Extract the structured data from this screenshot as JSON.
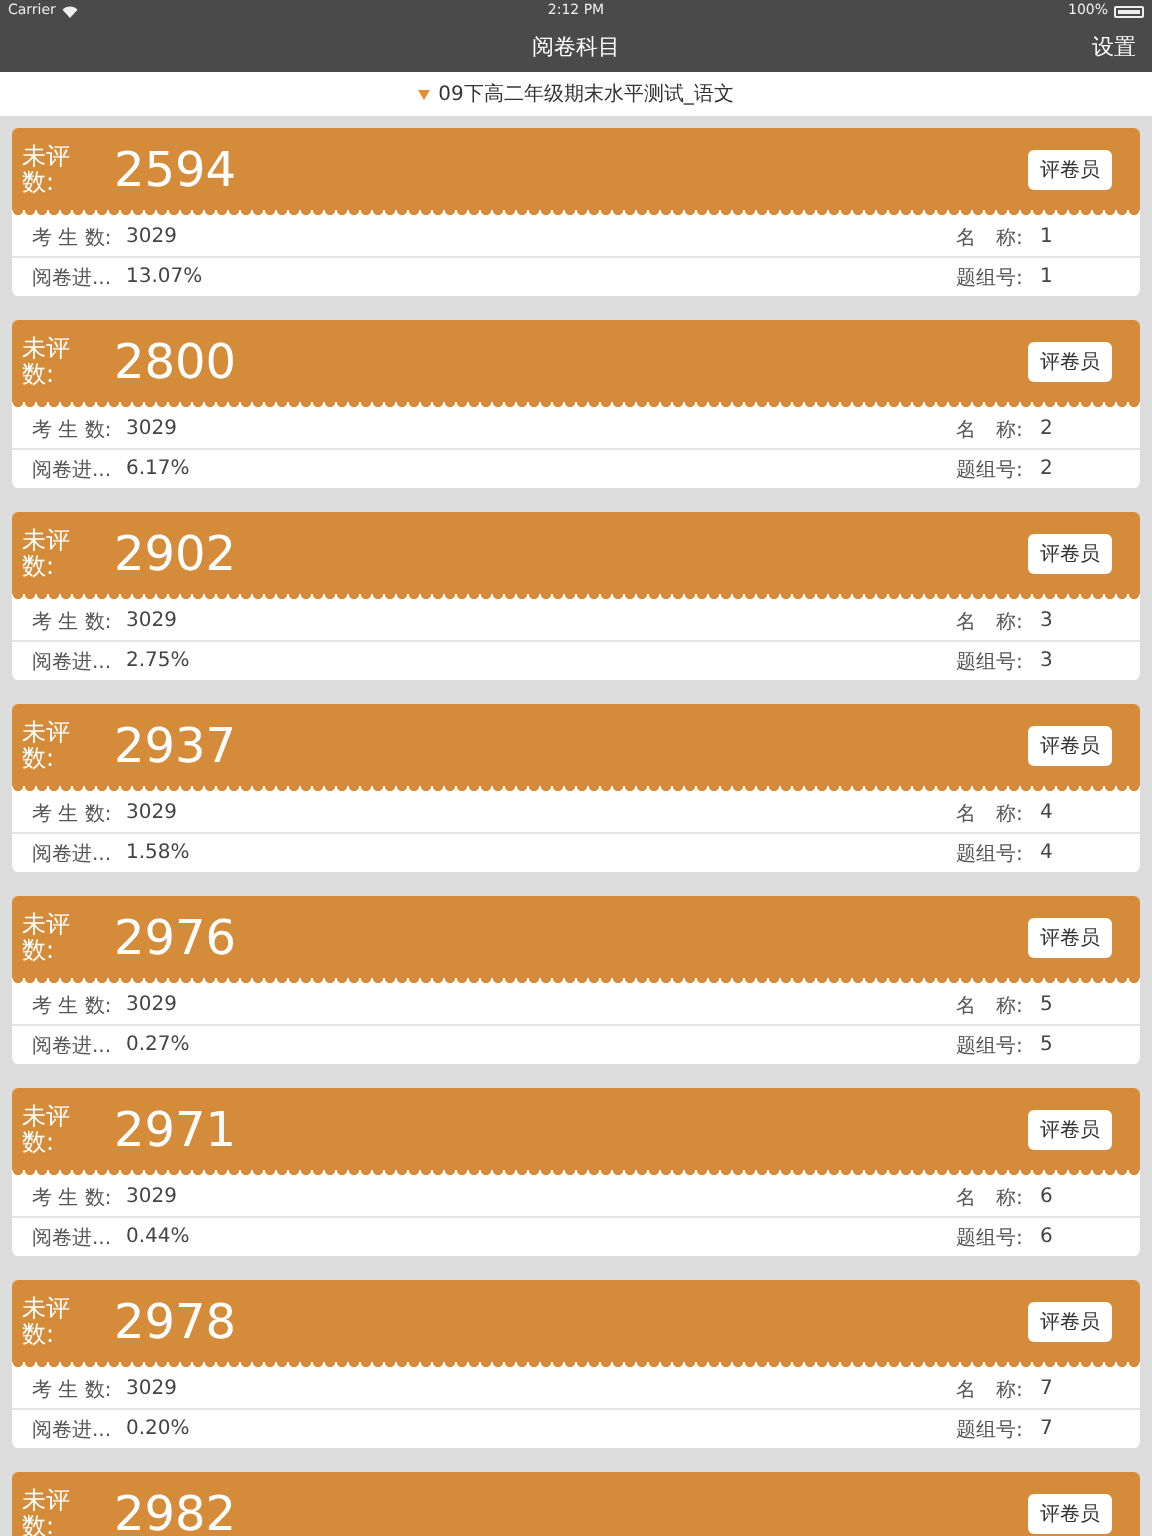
{
  "status_bar": {
    "carrier": "Carrier",
    "time": "2:12 PM",
    "battery": "100%"
  },
  "nav": {
    "title": "阅卷科目",
    "action": "设置"
  },
  "exam": {
    "title": "09下高二年级期末水平测试_语文"
  },
  "cards": [
    {
      "label": "未评数:",
      "count": "2594",
      "button": "评卷员",
      "rows": [
        {
          "left_label": "考 生 数:",
          "left_value": "3029",
          "right_label": "名　称:",
          "right_value": "1"
        },
        {
          "left_label": "阅卷进...",
          "left_value": "13.07%",
          "right_label": "题组号:",
          "right_value": "1"
        }
      ]
    },
    {
      "label": "未评数:",
      "count": "2800",
      "button": "评卷员",
      "rows": [
        {
          "left_label": "考 生 数:",
          "left_value": "3029",
          "right_label": "名　称:",
          "right_value": "2"
        },
        {
          "left_label": "阅卷进...",
          "left_value": "6.17%",
          "right_label": "题组号:",
          "right_value": "2"
        }
      ]
    },
    {
      "label": "未评数:",
      "count": "2902",
      "button": "评卷员",
      "rows": [
        {
          "left_label": "考 生 数:",
          "left_value": "3029",
          "right_label": "名　称:",
          "right_value": "3"
        },
        {
          "left_label": "阅卷进...",
          "left_value": "2.75%",
          "right_label": "题组号:",
          "right_value": "3"
        }
      ]
    },
    {
      "label": "未评数:",
      "count": "2937",
      "button": "评卷员",
      "rows": [
        {
          "left_label": "考 生 数:",
          "left_value": "3029",
          "right_label": "名　称:",
          "right_value": "4"
        },
        {
          "left_label": "阅卷进...",
          "left_value": "1.58%",
          "right_label": "题组号:",
          "right_value": "4"
        }
      ]
    },
    {
      "label": "未评数:",
      "count": "2976",
      "button": "评卷员",
      "rows": [
        {
          "left_label": "考 生 数:",
          "left_value": "3029",
          "right_label": "名　称:",
          "right_value": "5"
        },
        {
          "left_label": "阅卷进...",
          "left_value": "0.27%",
          "right_label": "题组号:",
          "right_value": "5"
        }
      ]
    },
    {
      "label": "未评数:",
      "count": "2971",
      "button": "评卷员",
      "rows": [
        {
          "left_label": "考 生 数:",
          "left_value": "3029",
          "right_label": "名　称:",
          "right_value": "6"
        },
        {
          "left_label": "阅卷进...",
          "left_value": "0.44%",
          "right_label": "题组号:",
          "right_value": "6"
        }
      ]
    },
    {
      "label": "未评数:",
      "count": "2978",
      "button": "评卷员",
      "rows": [
        {
          "left_label": "考 生 数:",
          "left_value": "3029",
          "right_label": "名　称:",
          "right_value": "7"
        },
        {
          "left_label": "阅卷进...",
          "left_value": "0.20%",
          "right_label": "题组号:",
          "right_value": "7"
        }
      ]
    },
    {
      "label": "未评数:",
      "count": "2982",
      "button": "评卷员"
    }
  ]
}
